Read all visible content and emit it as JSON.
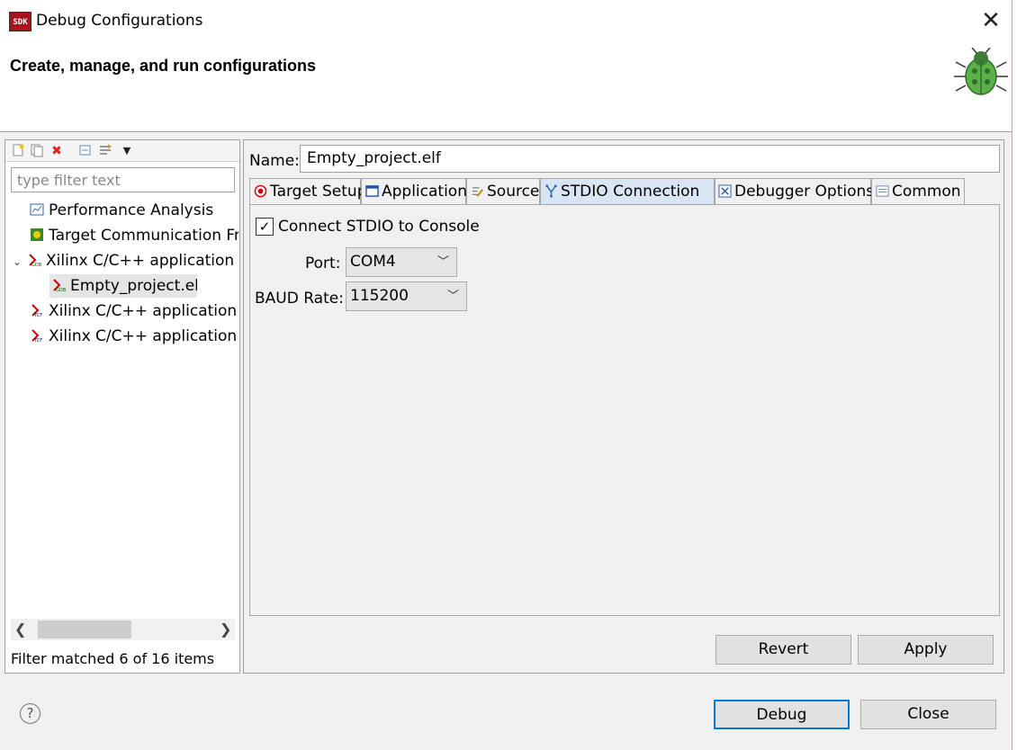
{
  "window": {
    "title": "Debug Configurations",
    "app_icon_text": "SDK"
  },
  "banner": {
    "title": "Create, manage, and run configurations"
  },
  "left": {
    "filter_placeholder": "type filter text",
    "tree": [
      {
        "label": "Performance Analysis",
        "icon": "chart-icon"
      },
      {
        "label": "Target Communication Fra",
        "icon": "tcf-icon"
      },
      {
        "label": "Xilinx C/C++ application (C",
        "icon": "xilinx-gdb-icon",
        "expanded": true
      },
      {
        "label": "Empty_project.elf",
        "icon": "xilinx-gdb-icon",
        "selected": true
      },
      {
        "label": "Xilinx C/C++ application (S",
        "icon": "xilinx-tcf-icon"
      },
      {
        "label": "Xilinx C/C++ application (S",
        "icon": "xilinx-tcf-icon"
      }
    ],
    "status": "Filter matched 6 of 16 items"
  },
  "right": {
    "name_label": "Name:",
    "name_value": "Empty_project.elf",
    "tabs": [
      {
        "label": "Target Setup",
        "icon": "target-icon"
      },
      {
        "label": "Application",
        "icon": "application-icon"
      },
      {
        "label": "Source",
        "icon": "source-icon"
      },
      {
        "label": "STDIO Connection",
        "icon": "connection-icon",
        "active": true
      },
      {
        "label": "Debugger Options",
        "icon": "debugger-icon"
      },
      {
        "label": "Common",
        "icon": "common-icon"
      }
    ],
    "stdio": {
      "connect_label": "Connect STDIO to Console",
      "connect_checked": true,
      "port_label": "Port:",
      "port_value": "COM4",
      "baud_label": "BAUD Rate:",
      "baud_value": "115200"
    },
    "revert_label": "Revert",
    "apply_label": "Apply"
  },
  "footer": {
    "debug_label": "Debug",
    "close_label": "Close",
    "help_glyph": "?"
  },
  "colors": {
    "accent": "#0078d7",
    "active_tab": "#d9e5f2",
    "selection": "#e5e5e5"
  }
}
